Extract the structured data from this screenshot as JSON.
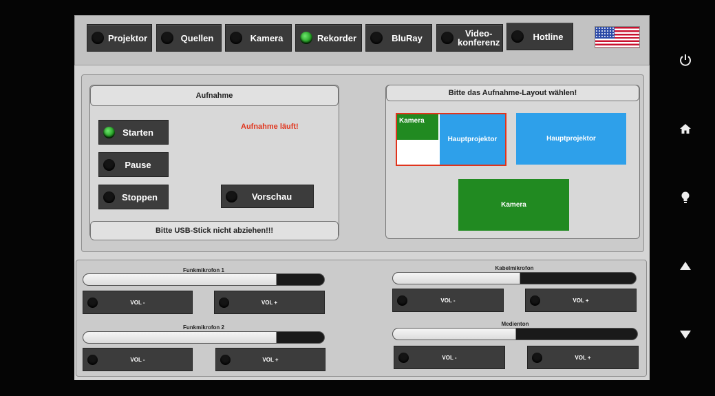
{
  "nav": {
    "items": [
      {
        "label": "Projektor",
        "active": false
      },
      {
        "label": "Quellen",
        "active": false
      },
      {
        "label": "Kamera",
        "active": false
      },
      {
        "label": "Rekorder",
        "active": true
      },
      {
        "label": "BluRay",
        "active": false
      },
      {
        "label": "Video-\nkonferenz",
        "active": false
      },
      {
        "label": "Hotline",
        "active": false
      }
    ],
    "language_flag": "us-flag-icon"
  },
  "recording": {
    "title": "Aufnahme",
    "start_label": "Starten",
    "pause_label": "Pause",
    "stop_label": "Stoppen",
    "preview_label": "Vorschau",
    "status_text": "Aufnahme läuft!",
    "footer": "Bitte USB-Stick nicht abziehen!!!",
    "start_active": true
  },
  "layout": {
    "title": "Bitte das Aufnahme-Layout wählen!",
    "option1": {
      "camera_label": "Kamera",
      "projector_label": "Hauptprojektor",
      "selected": true
    },
    "option2": {
      "projector_label": "Hauptprojektor"
    },
    "option3": {
      "camera_label": "Kamera"
    }
  },
  "audio": {
    "channels": [
      {
        "name": "Funkmikrofon 1",
        "level": 0.8,
        "vol_minus": "VOL -",
        "vol_plus": "VOL +"
      },
      {
        "name": "Kabelmikrofon",
        "level": 0.52,
        "vol_minus": "VOL -",
        "vol_plus": "VOL +"
      },
      {
        "name": "Funkmikrofon 2",
        "level": 0.8,
        "vol_minus": "VOL -",
        "vol_plus": "VOL +"
      },
      {
        "name": "Medienton",
        "level": 0.5,
        "vol_minus": "VOL -",
        "vol_plus": "VOL +"
      }
    ]
  },
  "hardware_buttons": [
    "power-icon",
    "home-icon",
    "lightbulb-icon",
    "arrow-up-icon",
    "arrow-down-icon"
  ],
  "colors": {
    "accent_green": "#1f9a1f",
    "status_red": "#e0341c",
    "layout_blue": "#2ea0ea",
    "layout_green": "#218a21"
  }
}
